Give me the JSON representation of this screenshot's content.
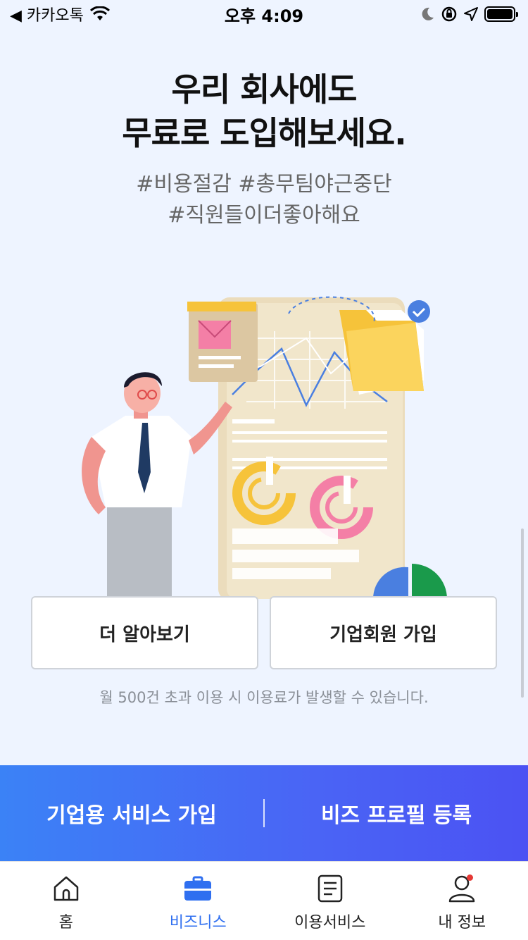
{
  "status_bar": {
    "back_label": "◀ 카카오톡",
    "time": "오후 4:09"
  },
  "headline": {
    "line1": "우리 회사에도",
    "line2": "무료로 도입해보세요."
  },
  "hashtags": {
    "line1": "#비용절감 #총무팀야근중단",
    "line2": "#직원들이더좋아해요"
  },
  "buttons": {
    "learn_more": "더 알아보기",
    "corporate_signup": "기업회원 가입"
  },
  "note": "월 500건 초과 이용 시 이용료가 발생할 수 있습니다.",
  "banner": {
    "left": "기업용 서비스 가입",
    "right": "비즈 프로필 등록"
  },
  "tabs": [
    {
      "label": "홈",
      "icon": "home-icon"
    },
    {
      "label": "비즈니스",
      "icon": "briefcase-icon",
      "active": true
    },
    {
      "label": "이용서비스",
      "icon": "document-icon"
    },
    {
      "label": "내 정보",
      "icon": "person-icon",
      "badge": true
    }
  ],
  "colors": {
    "accent": "#2f6ff0",
    "background": "#eef4ff",
    "banner_start": "#3b82f6",
    "banner_end": "#4b52f3"
  }
}
